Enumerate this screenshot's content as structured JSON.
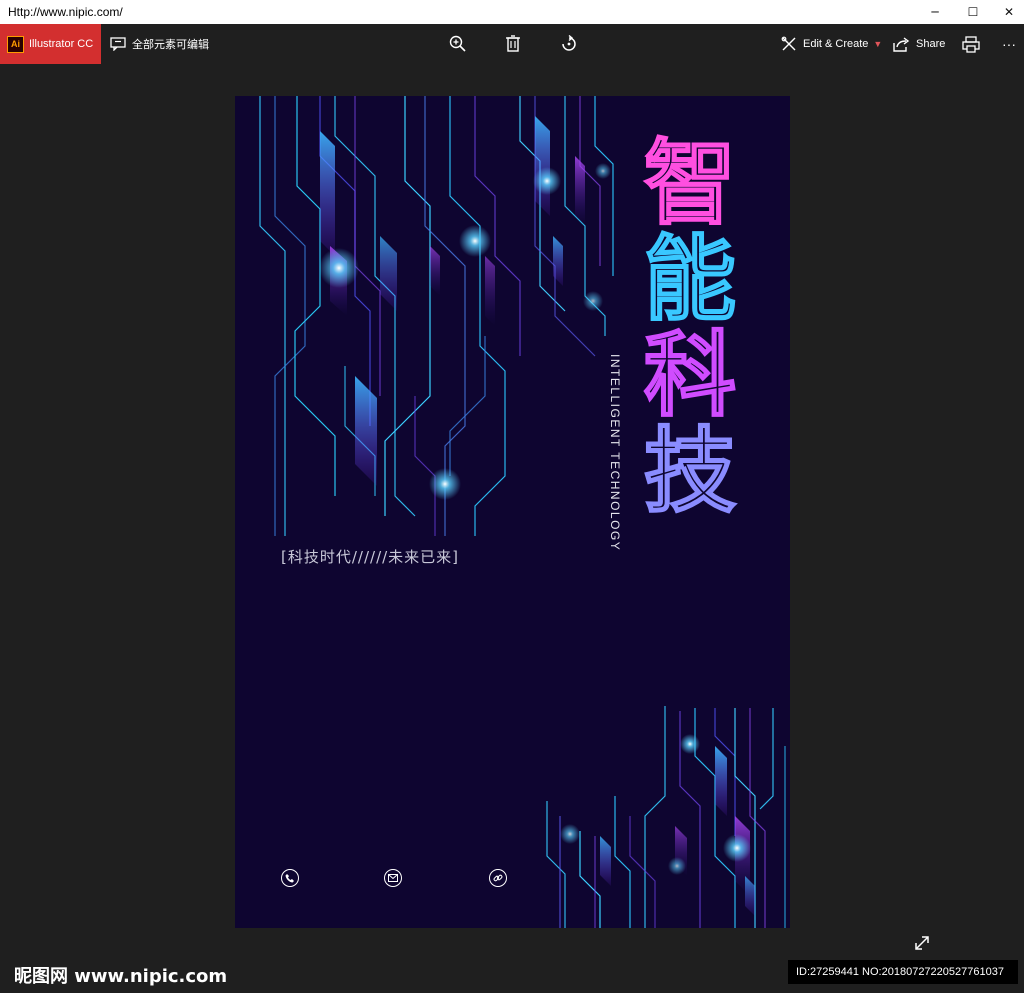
{
  "window": {
    "title": "Http://www.nipic.com/",
    "minimize_glyph": "─",
    "maximize_glyph": "☐",
    "close_glyph": "✕"
  },
  "toolbar": {
    "app_badge": "Ai",
    "app_label": "Illustrator CC",
    "edit_all_label": "全部元素可编辑",
    "zoom_icon": "zoom-in-icon",
    "delete_icon": "trash-icon",
    "rotate_icon": "rotate-icon",
    "edit_create_label": "Edit & Create",
    "share_label": "Share",
    "print_icon": "print-icon",
    "more_label": "···"
  },
  "poster": {
    "title_chars": [
      "智",
      "能",
      "科",
      "技"
    ],
    "subtitle_en": "INTELLIGENT TECHNOLOGY",
    "slogan": "[科技时代//////未来已来]",
    "contact_icons": [
      "phone-icon",
      "mail-icon",
      "link-icon"
    ]
  },
  "watermark": {
    "logo": "昵图网 www.nipic.com",
    "id_text": "ID:27259441 NO:20180727220527761037"
  },
  "colors": {
    "poster_bg": "#0e0530",
    "accent_cyan": "#39c8ff",
    "accent_magenta": "#ff4fe0",
    "ai_red": "#d32f2f"
  }
}
